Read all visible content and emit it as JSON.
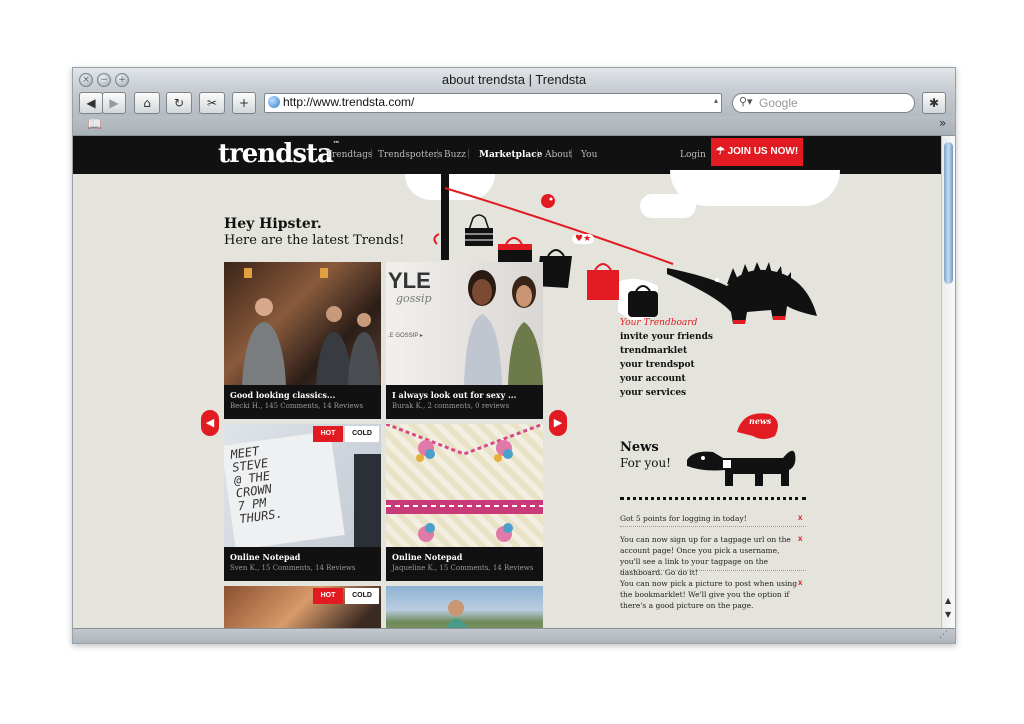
{
  "window": {
    "title": "about trendsta | Trendsta",
    "url": "http://www.trendsta.com/",
    "search_placeholder": "Google"
  },
  "site": {
    "logo": "trendsta",
    "logo_tm": "™",
    "nav": [
      "Trendtags",
      "Trendspotters",
      "Buzz",
      "Marketplace",
      "About",
      "You"
    ],
    "login": "Login",
    "join": "JOIN US NOW!",
    "greeting": "Hey Hipster.",
    "greeting_sub": "Here are the latest Trends!",
    "bird_text": "♥★",
    "news_bubble": "news",
    "cards": [
      {
        "title": "Good looking classics...",
        "meta": "Becki H., 145 Comments, 14 Reviews"
      },
      {
        "title": "I always look out for sexy ...",
        "meta": "Burak K., 2 comments, 0 reviews",
        "photo_text": "YLE",
        "photo_sub": "gossip",
        "photo_tag": ".E GOSSIP ▸"
      },
      {
        "title": "Online Notepad",
        "meta": "Sven K., 15 Comments, 14 Reviews",
        "hot": "HOT",
        "cold": "COLD",
        "note": "MEET\nSTEVE\n@ THE\nCROWN\n7 PM\nTHURS."
      },
      {
        "title": "Online Notepad",
        "meta": "Jaqueline K., 15 Comments, 14 Reviews"
      },
      {
        "hot": "HOT",
        "cold": "COLD"
      },
      {}
    ],
    "links": {
      "title": "Your Trendboard",
      "items": [
        "invite your friends",
        "trendmarklet",
        "your trendspot",
        "your account",
        "your services"
      ]
    },
    "news": {
      "heading": "News",
      "sub": "For you!",
      "items": [
        "Got 5 points for logging in today!",
        "You can now sign up for a tagpage url on the account page! Once you pick a username, you'll see a link to your tagpage on the dashboard. Go do it!",
        "You can now pick a picture to post when using the bookmarklet! We'll give you the option if there's a good picture on the page."
      ],
      "close": "x"
    }
  },
  "colors": {
    "accent": "#e21b23",
    "nav_bg": "#111111",
    "page_bg": "#e4e3dc"
  },
  "icons": [
    "close-icon",
    "minimize-icon",
    "zoom-icon",
    "back-icon",
    "forward-icon",
    "home-icon",
    "reload-icon",
    "clip-icon",
    "add-icon",
    "globe-icon",
    "search-icon",
    "bug-icon",
    "book-icon",
    "overflow-icon",
    "umbrella-icon"
  ]
}
